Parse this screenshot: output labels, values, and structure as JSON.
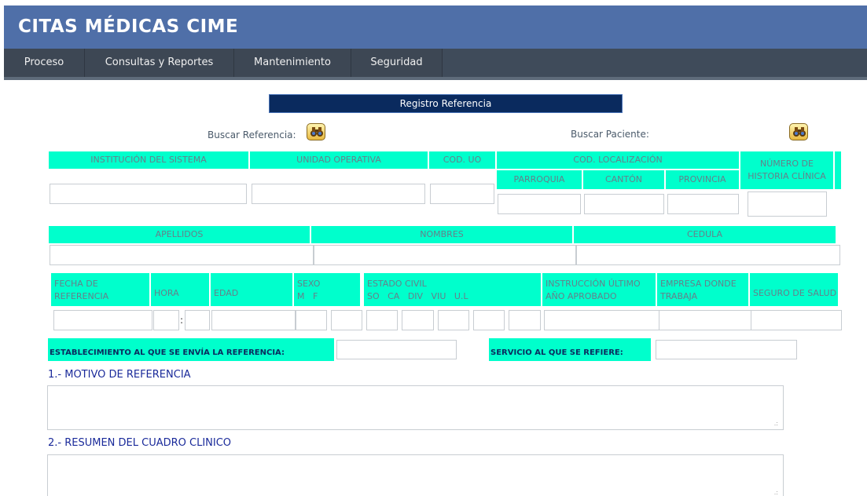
{
  "app": {
    "title": "CITAS MÉDICAS CIME"
  },
  "menu": [
    "Proceso",
    "Consultas y Reportes",
    "Mantenimiento",
    "Seguridad"
  ],
  "form": {
    "title": "Registro Referencia",
    "search_referencia": "Buscar Referencia:",
    "search_paciente": "Buscar Paciente:"
  },
  "row1": {
    "institucion": "INSTITUCIÓN DEL SISTEMA",
    "unidad": "UNIDAD OPERATIVA",
    "cod_uo": "COD. UO",
    "cod_loc": "COD. LOCALIZACIÓN",
    "parroquia": "PARROQUIA",
    "canton": "CANTÓN",
    "provincia": "PROVINCIA",
    "historia_1": "NÚMERO DE",
    "historia_2": "HISTORIA CLÍNICA"
  },
  "row2": {
    "apellidos": "APELLIDOS",
    "nombres": "NOMBRES",
    "cedula": "CEDULA"
  },
  "row3": {
    "fecha_1": "FECHA DE",
    "fecha_2": "REFERENCIA",
    "hora": "HORA",
    "edad": "EDAD",
    "sexo": "SEXO",
    "sexo_opts": "M   F",
    "estado": "ESTADO CIVIL",
    "estado_opts": "SO   CA   DIV   VIU   U.L",
    "instruccion_1": "INSTRUCCIÓN ÚLTIMO",
    "instruccion_2": "AÑO APROBADO",
    "empresa_1": "EMPRESA DONDE",
    "empresa_2": "TRABAJA",
    "seguro": "SEGURO DE SALUD",
    "colon": ":"
  },
  "row4": {
    "establecimiento": "ESTABLECIMIENTO AL QUE SE ENVÍA LA REFERENCIA:",
    "servicio": "SERVICIO AL QUE SE REFIERE:"
  },
  "sections": {
    "motivo": "1.- MOTIVO DE REFERENCIA",
    "resumen": "2.- RESUMEN DEL CUADRO CLINICO"
  },
  "icons": {
    "search": "binoculars-icon",
    "resize": "resize-grip-icon"
  }
}
